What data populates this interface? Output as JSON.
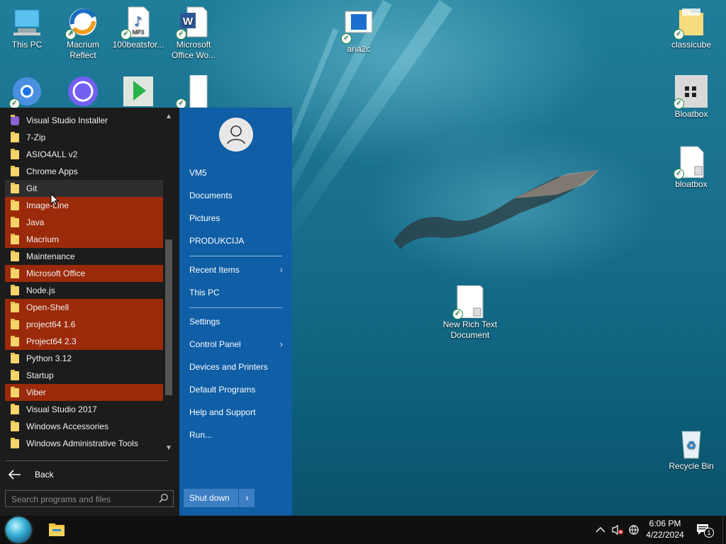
{
  "desktop": {
    "icons": [
      {
        "label": "This PC",
        "icon": "computer-icon"
      },
      {
        "label": "Macrium Reflect",
        "icon": "macrium-reflect-icon"
      },
      {
        "label": "100beatsfor...",
        "icon": "mp3-file-icon"
      },
      {
        "label": "Microsoft Office Wo...",
        "icon": "word-document-icon"
      },
      {
        "label": "aria2c",
        "icon": "aria2c-app-icon"
      },
      {
        "label": "classicube",
        "icon": "folder-icon"
      },
      {
        "label": "Bloatbox",
        "icon": "bloatbox-icon"
      },
      {
        "label": "bloatbox",
        "icon": "text-file-icon"
      },
      {
        "label": "New Rich Text Document",
        "icon": "rich-text-document-icon"
      },
      {
        "label": "Recycle Bin",
        "icon": "recycle-bin-icon"
      }
    ],
    "partial_icons": [
      "chrome-icon",
      "viber-icon",
      "mp3-player-icon",
      "document-icon"
    ]
  },
  "start_menu": {
    "programs": [
      {
        "label": "Visual Studio Installer",
        "highlight": false
      },
      {
        "label": "7-Zip",
        "highlight": false
      },
      {
        "label": "ASIO4ALL v2",
        "highlight": false
      },
      {
        "label": "Chrome Apps",
        "highlight": false
      },
      {
        "label": "Git",
        "highlight": false,
        "hover": true
      },
      {
        "label": "Image-Line",
        "highlight": true
      },
      {
        "label": "Java",
        "highlight": true
      },
      {
        "label": "Macrium",
        "highlight": true
      },
      {
        "label": "Maintenance",
        "highlight": false
      },
      {
        "label": "Microsoft Office",
        "highlight": true
      },
      {
        "label": "Node.js",
        "highlight": false
      },
      {
        "label": "Open-Shell",
        "highlight": true
      },
      {
        "label": "project64 1.6",
        "highlight": true
      },
      {
        "label": "Project64 2.3",
        "highlight": true
      },
      {
        "label": "Python 3.12",
        "highlight": false
      },
      {
        "label": "Startup",
        "highlight": false
      },
      {
        "label": "Viber",
        "highlight": true
      },
      {
        "label": "Visual Studio 2017",
        "highlight": false
      },
      {
        "label": "Windows Accessories",
        "highlight": false
      },
      {
        "label": "Windows Administrative Tools",
        "highlight": false
      }
    ],
    "back_label": "Back",
    "search_placeholder": "Search programs and files",
    "right_items": [
      {
        "label": "VM5"
      },
      {
        "label": "Documents"
      },
      {
        "label": "Pictures"
      },
      {
        "label": "PRODUKCIJA"
      },
      {
        "label": "Recent Items",
        "submenu": true
      },
      {
        "label": "This PC"
      },
      {
        "label": "Settings"
      },
      {
        "label": "Control Panel",
        "submenu": true
      },
      {
        "label": "Devices and Printers"
      },
      {
        "label": "Default Programs"
      },
      {
        "label": "Help and Support"
      },
      {
        "label": "Run..."
      }
    ],
    "shutdown_label": "Shut down",
    "highlight_color": "#9b2a0a",
    "panel_color": "#0f5ea6"
  },
  "taskbar": {
    "time": "6:06 PM",
    "date": "4/22/2024",
    "notification_count": "1"
  }
}
